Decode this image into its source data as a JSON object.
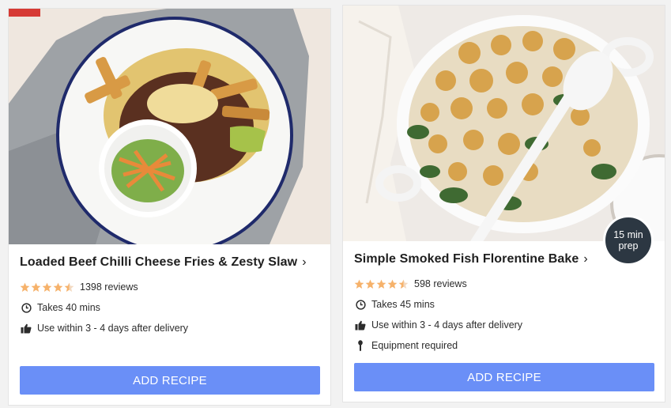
{
  "recipes": [
    {
      "title": "Loaded Beef Chilli Cheese Fries & Zesty Slaw",
      "chevron": "›",
      "rating": 4.5,
      "reviews": "1398 reviews",
      "time": "Takes 40 mins",
      "storage": "Use within 3 - 4 days after delivery",
      "button": "ADD RECIPE"
    },
    {
      "title": "Simple Smoked Fish Florentine Bake",
      "chevron": "›",
      "rating": 4.5,
      "reviews": "598 reviews",
      "time": "Takes 45 mins",
      "storage": "Use within 3 - 4 days after delivery",
      "equipment": "Equipment required",
      "button": "ADD RECIPE",
      "badge": {
        "line1": "15 min",
        "line2": "prep"
      }
    }
  ],
  "colors": {
    "button": "#6a8ff7",
    "star": "#f6b26b",
    "badge": "#2c3742"
  },
  "icons": [
    "star-icon",
    "clock-icon",
    "thumbs-up-icon",
    "utensil-icon",
    "chevron-right-icon"
  ]
}
